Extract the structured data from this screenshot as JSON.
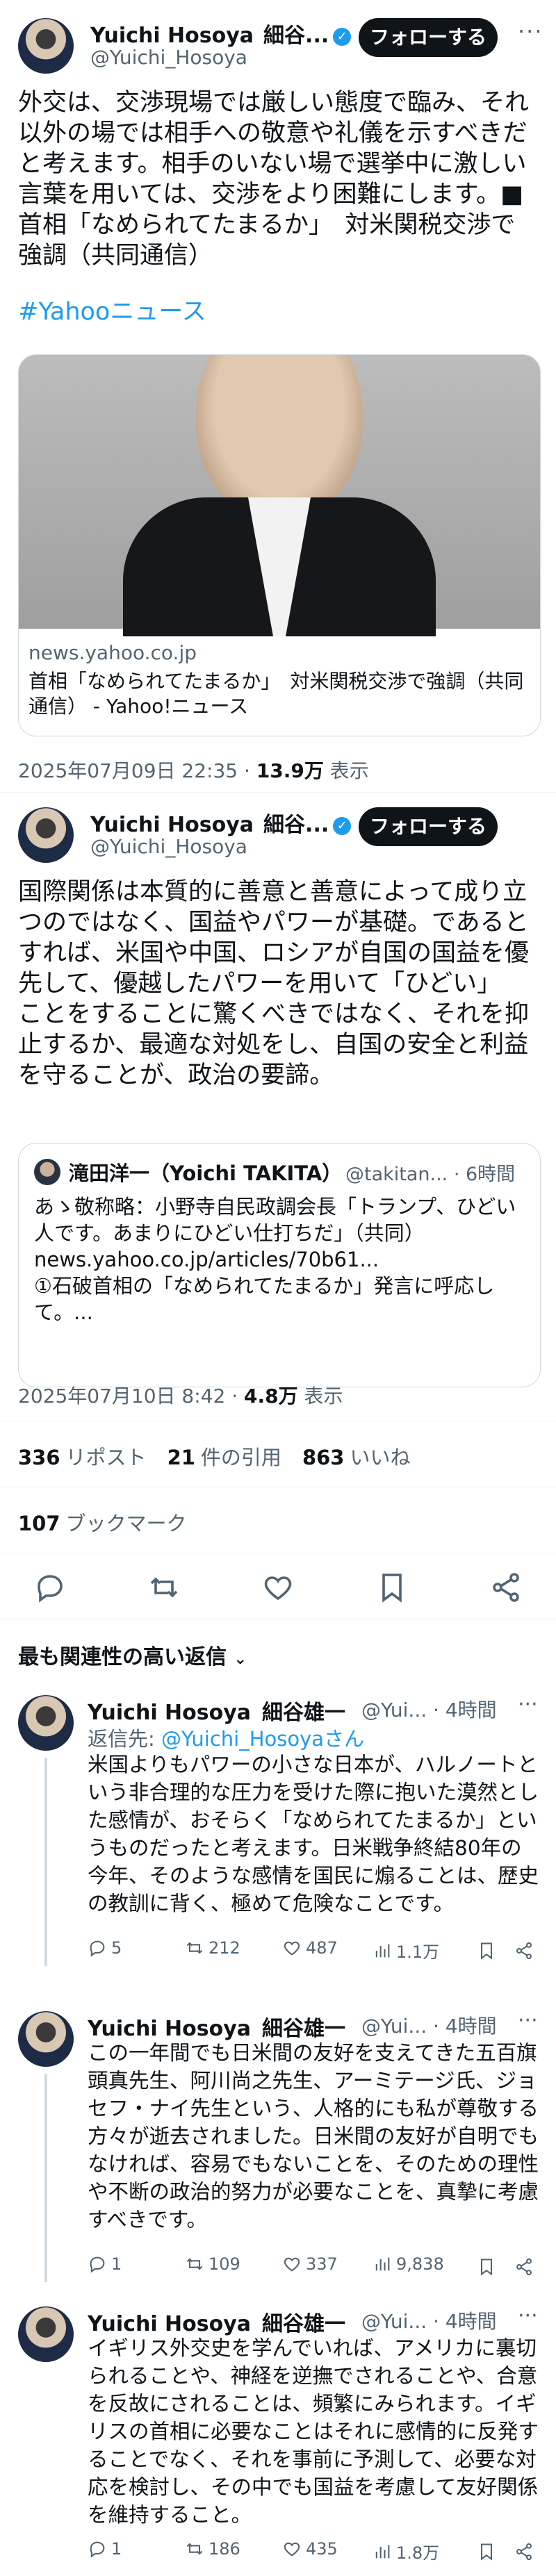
{
  "colors": {
    "accent": "#1d9bf0",
    "text": "#0f1419",
    "muted": "#536471",
    "border": "#cfd9de"
  },
  "tweet1": {
    "name": "Yuichi Hosoya",
    "name_jp": "細谷...",
    "handle": "@Yuichi_Hosoya",
    "follow_label": "フォローする",
    "text": "外交は、交渉現場では厳しい態度で臨み、それ以外の場では相手への敬意や礼儀を示すべきだと考えます。相手のいない場で選挙中に激しい言葉を用いては、交渉をより困難にします。■首相「なめられてたまるか」　対米関税交渉で強調（共同通信）",
    "hashtag": "#Yahooニュース",
    "card": {
      "domain": "news.yahoo.co.jp",
      "title": "首相「なめられてたまるか」　対米関税交渉で強調（共同通信） - Yahoo!ニュース"
    },
    "timestamp": "2025年07月09日 22:35 · ",
    "views": "13.9万",
    "views_label": " 表示"
  },
  "tweet2": {
    "name": "Yuichi Hosoya",
    "name_jp": "細谷...",
    "handle": "@Yuichi_Hosoya",
    "follow_label": "フォローする",
    "text": "国際関係は本質的に善意と善意によって成り立つのではなく、国益やパワーが基礎。であるとすれば、米国や中国、ロシアが自国の国益を優先して、優越したパワーを用いて「ひどい」\nことをすることに驚くべきではなく、それを抑止するか、最適な対処をし、自国の安全と利益を守ることが、政治の要諦。",
    "quote": {
      "name": "滝田洋一（Yoichi TAKITA）",
      "handle": "@takitan... · 6時間",
      "text": "あゝ敬称略：小野寺自民政調会長「トランプ、ひどい人です。あまりにひどい仕打ちだ」（共同）\nnews.yahoo.co.jp/articles/70b61...\n①石破首相の「なめられてたまるか」発言に呼応して。..."
    },
    "timestamp": "2025年07月10日 8:42 · ",
    "views": "4.8万",
    "views_label": " 表示"
  },
  "stats": {
    "retweets": "336",
    "retweets_label": "リポスト",
    "quotes": "21",
    "quotes_label": "件の引用",
    "likes": "863",
    "likes_label": "いいね",
    "bookmarks": "107",
    "bookmarks_label": "ブックマーク"
  },
  "sort_label": "最も関連性の高い返信",
  "replies": [
    {
      "name": "Yuichi Hosoya",
      "name_jp": "細谷雄一",
      "handle": "@Yui... · 4時間",
      "reply_to_prefix": "返信先: ",
      "reply_to": "@Yuichi_Hosoyaさん",
      "text": "米国よりもパワーの小さな日本が、ハルノートという非合理的な圧力を受けた際に抱いた漠然とした感情が、おそらく「なめられてたまるか」というものだったと考えます。日米戦争終結80年の今年、そのような感情を国民に煽ることは、歴史の教訓に背く、極めて危険なことです。",
      "replies": "5",
      "retweets": "212",
      "likes": "487",
      "views": "1.1万"
    },
    {
      "name": "Yuichi Hosoya",
      "name_jp": "細谷雄一",
      "handle": "@Yui... · 4時間",
      "text": "この一年間でも日米間の友好を支えてきた五百旗頭真先生、阿川尚之先生、アーミテージ氏、ジョセフ・ナイ先生という、人格的にも私が尊敬する方々が逝去されました。日米間の友好が自明でもなければ、容易でもないことを、そのための理性や不断の政治的努力が必要なことを、真摯に考慮すべきです。",
      "replies": "1",
      "retweets": "109",
      "likes": "337",
      "views": "9,838"
    },
    {
      "name": "Yuichi Hosoya",
      "name_jp": "細谷雄一",
      "handle": "@Yui... · 4時間",
      "text": "イギリス外交史を学んでいれば、アメリカに裏切られることや、神経を逆撫でされることや、合意を反故にされることは、頻繁にみられます。イギリスの首相に必要なことはそれに感情的に反発することでなく、それを事前に予測して、必要な対応を検討し、その中でも国益を考慮して友好関係を維持すること。",
      "replies": "1",
      "retweets": "186",
      "likes": "435",
      "views": "1.8万"
    }
  ]
}
